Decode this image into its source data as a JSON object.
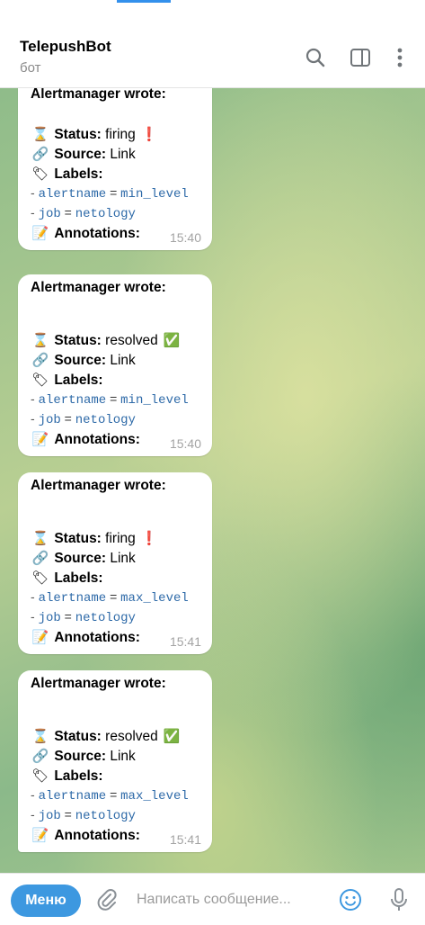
{
  "header": {
    "title": "TelepushBot",
    "subtitle": "бот"
  },
  "messages": [
    {
      "wrote": "Alertmanager wrote:",
      "status_label": "Status:",
      "status_value": "firing",
      "status_emoji": "❗",
      "source_label": "Source:",
      "source_value": "Link",
      "labels_label": "Labels:",
      "label1_key": "alertname",
      "label1_value": "min_level",
      "label2_key": "job",
      "label2_value": "netology",
      "annotations_label": "Annotations:",
      "time": "15:40"
    },
    {
      "wrote": "Alertmanager wrote:",
      "status_label": "Status:",
      "status_value": "resolved",
      "status_emoji": "✅",
      "source_label": "Source:",
      "source_value": "Link",
      "labels_label": "Labels:",
      "label1_key": "alertname",
      "label1_value": "min_level",
      "label2_key": "job",
      "label2_value": "netology",
      "annotations_label": "Annotations:",
      "time": "15:40"
    },
    {
      "wrote": "Alertmanager wrote:",
      "status_label": "Status:",
      "status_value": "firing",
      "status_emoji": "❗",
      "source_label": "Source:",
      "source_value": "Link",
      "labels_label": "Labels:",
      "label1_key": "alertname",
      "label1_value": "max_level",
      "label2_key": "job",
      "label2_value": "netology",
      "annotations_label": "Annotations:",
      "time": "15:41"
    },
    {
      "wrote": "Alertmanager wrote:",
      "status_label": "Status:",
      "status_value": "resolved",
      "status_emoji": "✅",
      "source_label": "Source:",
      "source_value": "Link",
      "labels_label": "Labels:",
      "label1_key": "alertname",
      "label1_value": "max_level",
      "label2_key": "job",
      "label2_value": "netology",
      "annotations_label": "Annotations:",
      "time": "15:41"
    }
  ],
  "composer": {
    "menu_label": "Меню",
    "placeholder": "Написать сообщение..."
  },
  "icons": {
    "search": "search-icon",
    "sidebar": "sidebar-toggle-icon",
    "more": "more-vertical-icon",
    "attach": "paperclip-icon",
    "emoji": "smile-icon",
    "mic": "microphone-icon"
  },
  "colors": {
    "accent": "#3d98e0",
    "link": "#2e6aa8",
    "timestamp": "#a3a3a3"
  }
}
